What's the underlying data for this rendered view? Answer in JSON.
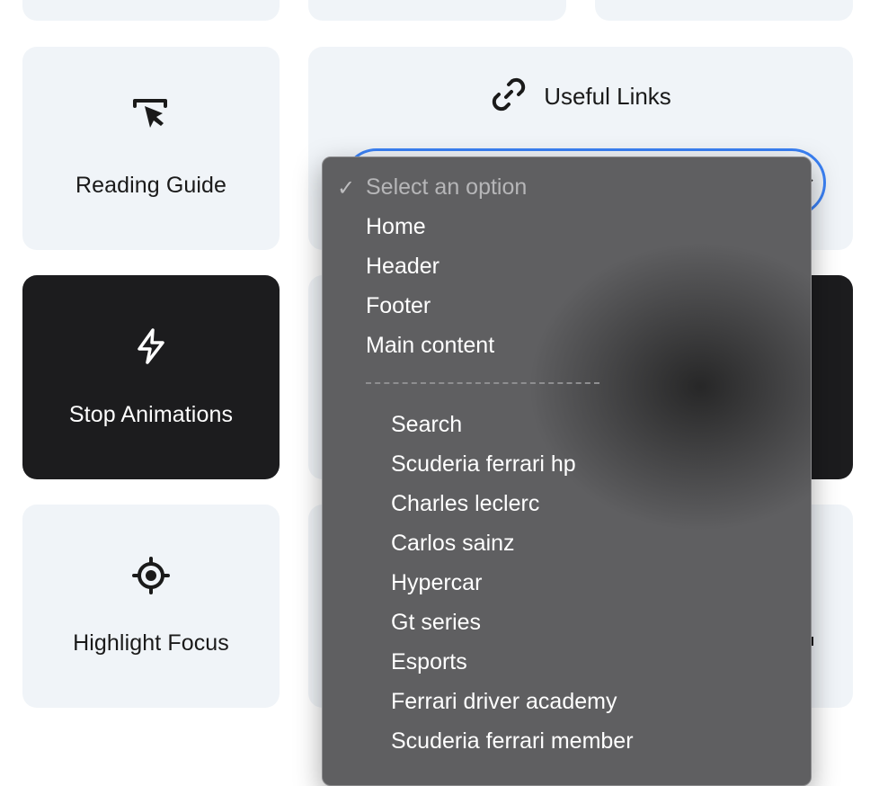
{
  "tiles": {
    "reading_guide": {
      "label": "Reading Guide",
      "icon": "pointer-cursor-icon"
    },
    "stop_animations": {
      "label": "Stop Animations",
      "icon": "lightning-bolt-icon"
    },
    "highlight_focus": {
      "label": "Highlight Focus",
      "icon": "crosshair-target-icon"
    }
  },
  "useful_links": {
    "title": "Useful Links",
    "icon": "link-icon",
    "select": {
      "placeholder": "Select an option",
      "options": [
        "Home",
        "Header",
        "Footer",
        "Main content"
      ],
      "separator": "——————————————",
      "sub_options": [
        "Search",
        "Scuderia ferrari hp",
        "Charles leclerc",
        "Carlos sainz",
        "Hypercar",
        "Gt series",
        "Esports",
        "Ferrari driver academy",
        "Scuderia ferrari member"
      ]
    }
  },
  "colors": {
    "card_bg": "#f0f4f8",
    "dark_card_bg": "#1c1c1e",
    "select_focus_border": "#3b82f6",
    "dropdown_bg": "#5f5f61"
  }
}
